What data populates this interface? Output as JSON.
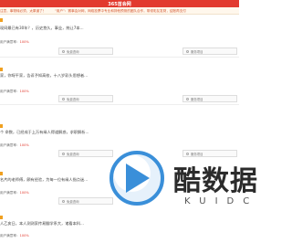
{
  "header": {
    "title": "365首会网"
  },
  "notice": {
    "part1": "注意，事物转必须，太厚道了！",
    "part2": "“用户”：赛事会对网，网络投票中专业和排他预测的团队合作，带领彩友发财，结账再支付"
  },
  "cards": [
    {
      "question": "现网最已有30年？，历史悠久，事业，统让7本...",
      "satisfaction_label": "用户满意率：",
      "satisfaction_value": "100%",
      "btn_free": "免费咨询",
      "btn_report": "服务项目"
    },
    {
      "question": "家，你呀平家，告诉予知高校，十八岁彩头思想者...",
      "satisfaction_label": "用户满意率：",
      "satisfaction_value": "100%",
      "btn_free": "免费咨询",
      "btn_report": "服务项目"
    },
    {
      "question": "个 命数，已经成于上万有缘人得道解惑，求职解析...",
      "satisfaction_label": "用户满意率：",
      "satisfaction_value": "100%",
      "btn_free": "免费咨询",
      "btn_report": "服务项目"
    },
    {
      "question": "名片的老师傅，颇有经验，为每一位有缘人指点迷...",
      "satisfaction_label": "用户满意率：",
      "satisfaction_value": "100%",
      "btn_free": "免费咨询",
      "btn_report": "服务项目"
    },
    {
      "question": "人乙亥日，本人测测家传易翻学系大，诸看本科...",
      "satisfaction_label": "用户满意率：",
      "satisfaction_value": "100%",
      "btn_free": "免费咨询",
      "btn_report": "服务项目"
    }
  ],
  "watermark": {
    "brand": "酷数据",
    "sub": "KUIDC",
    "brand_color": "#3a8fd9"
  }
}
